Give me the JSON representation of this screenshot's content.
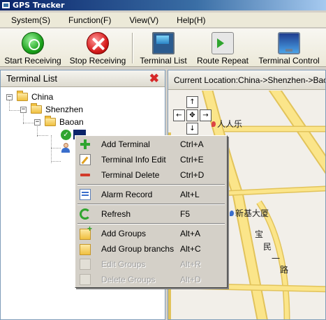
{
  "window": {
    "title": "GPS Tracker"
  },
  "menubar": [
    {
      "label": "System(S)"
    },
    {
      "label": "Function(F)"
    },
    {
      "label": "View(V)"
    },
    {
      "label": "Help(H)"
    }
  ],
  "toolbar": {
    "start": "Start Receiving",
    "stop": "Stop Receiving",
    "terminal_list": "Terminal List",
    "route_repeat": "Route Repeat",
    "terminal_control": "Terminal Control"
  },
  "left_panel": {
    "title": "Terminal List"
  },
  "tree": {
    "china": "China",
    "shenzhen": "Shenzhen",
    "baoan": "Baoan",
    "terminal1": "",
    "terminal2": ""
  },
  "map": {
    "location": "Current Location:China->Shenzhen->Baoan",
    "nav": {
      "up": "↑",
      "down": "↓",
      "left": "←",
      "right": "→",
      "center": "✥"
    },
    "places": [
      {
        "name": "人人乐"
      },
      {
        "name": "新基大厦"
      },
      {
        "name": "宝"
      },
      {
        "name": "民"
      },
      {
        "name": "一"
      },
      {
        "name": "路"
      }
    ],
    "colors": {
      "road": "#fbe58a",
      "road_edge": "#e2c35a",
      "land": "#f2efe9"
    }
  },
  "context_menu": {
    "items": [
      {
        "label": "Add Terminal",
        "shortcut": "Ctrl+A",
        "icon": "add-icon",
        "enabled": true
      },
      {
        "label": "Terminal Info Edit",
        "shortcut": "Ctrl+E",
        "icon": "edit-icon",
        "enabled": true
      },
      {
        "label": "Terminal Delete",
        "shortcut": "Ctrl+D",
        "icon": "delete-icon",
        "enabled": true
      },
      {
        "label": "Alarm Record",
        "shortcut": "Alt+L",
        "icon": "alarm-record-icon",
        "enabled": true
      },
      {
        "label": "Refresh",
        "shortcut": "F5",
        "icon": "refresh-icon",
        "enabled": true
      },
      {
        "label": "Add Groups",
        "shortcut": "Alt+A",
        "icon": "add-group-icon",
        "enabled": true
      },
      {
        "label": "Add Group branchs",
        "shortcut": "Alt+C",
        "icon": "add-group-branch-icon",
        "enabled": true
      },
      {
        "label": "Edit Groups",
        "shortcut": "Alt+R",
        "icon": "edit-group-icon",
        "enabled": false
      },
      {
        "label": "Delete Groups",
        "shortcut": "Alt+D",
        "icon": "delete-group-icon",
        "enabled": false
      }
    ]
  }
}
